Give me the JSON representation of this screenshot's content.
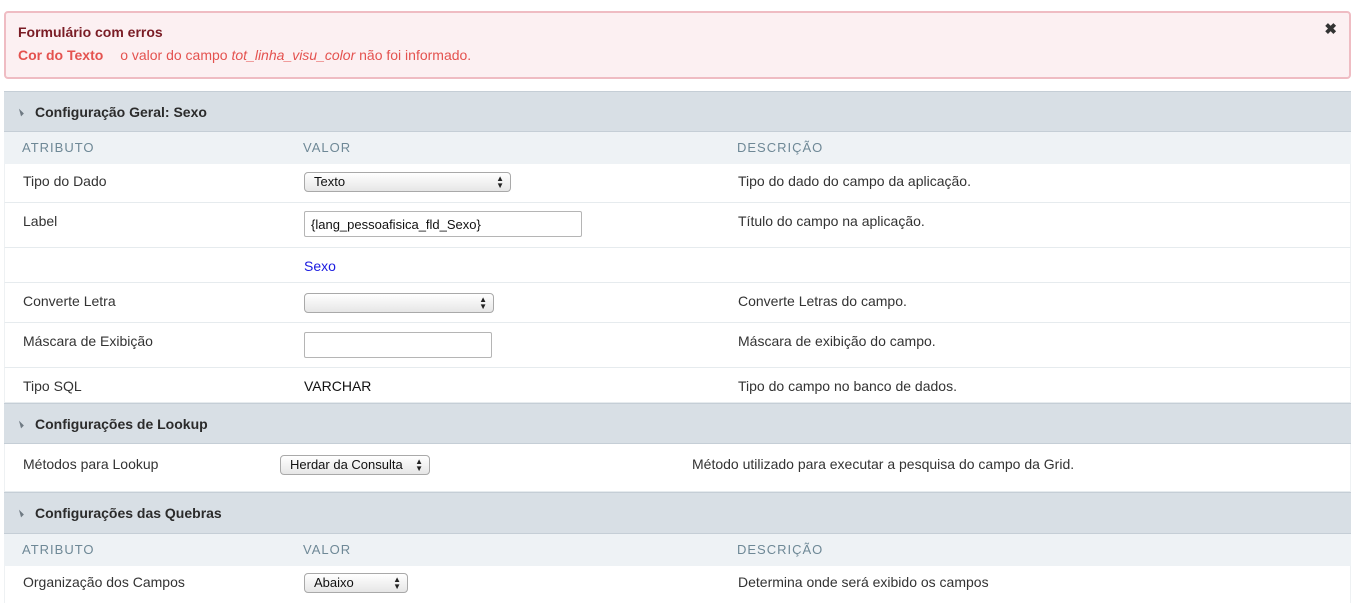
{
  "error": {
    "title": "Formulário com erros",
    "field": "Cor do Texto",
    "message_prefix": "o valor do campo ",
    "message_field": "tot_linha_visu_color",
    "message_suffix": " não foi informado."
  },
  "columns": {
    "attribute": "ATRIBUTO",
    "value": "VALOR",
    "description": "DESCRIÇÃO"
  },
  "section_general": {
    "title": "Configuração Geral: Sexo",
    "tipo_dado": {
      "label": "Tipo do Dado",
      "value": "Texto",
      "description": "Tipo do dado do campo da aplicação."
    },
    "label": {
      "label": "Label",
      "value": "{lang_pessoafisica_fld_Sexo}",
      "description": "Título do campo na aplicação."
    },
    "label_preview": "Sexo",
    "converte": {
      "label": "Converte Letra",
      "value": "",
      "description": "Converte Letras do campo."
    },
    "mascara": {
      "label": "Máscara de Exibição",
      "value": "",
      "description": "Máscara de exibição do campo."
    },
    "tipo_sql": {
      "label": "Tipo SQL",
      "value": "VARCHAR",
      "description": "Tipo do campo no banco de dados."
    }
  },
  "section_lookup": {
    "title": "Configurações de Lookup",
    "metodos": {
      "label": "Métodos para Lookup",
      "value": "Herdar da Consulta",
      "description": "Método utilizado para executar a pesquisa do campo da Grid."
    }
  },
  "section_breaks": {
    "title": "Configurações das Quebras",
    "organizacao": {
      "label": "Organização dos Campos",
      "value": "Abaixo",
      "description": "Determina onde será exibido os campos"
    }
  },
  "icons": {
    "close": "close-icon",
    "collapse": "collapse-triangle-icon",
    "select_arrows": "select-arrows-icon"
  },
  "colors": {
    "error_title": "#7a1c25",
    "error_text": "#e4524f",
    "link": "#1a1ae0",
    "section_header": "#d8dfe5"
  }
}
